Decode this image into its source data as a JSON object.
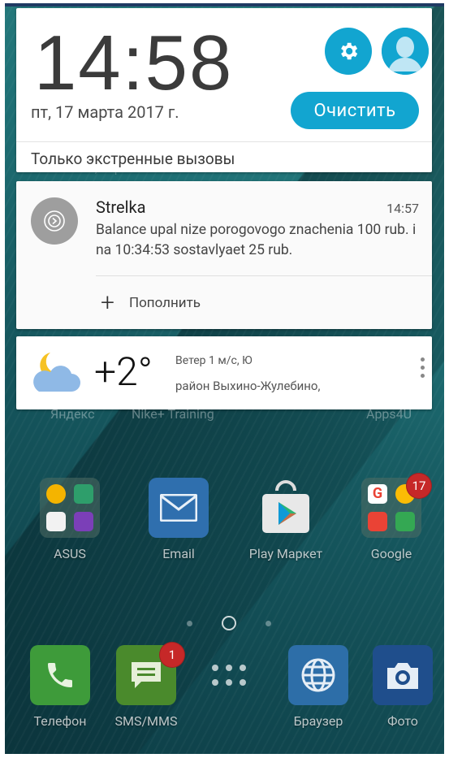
{
  "status_header": {
    "time": "14:58",
    "date": "пт, 17 марта 2017 г.",
    "clear_button": "Очистить",
    "emergency_text": "Только экстренные вызовы",
    "accent_color": "#12a5d0"
  },
  "notification": {
    "app_name": "Strelka",
    "time": "14:57",
    "body": "Balance upal nize porogovogo znachenia 100 rub. i na 10:34:53 sostavlyaet 25 rub.",
    "action_label": "Пополнить"
  },
  "weather": {
    "temperature": "+2°",
    "wind": "Ветер 1 м/с, Ю",
    "location": "район Выхино-Жулебино,"
  },
  "home": {
    "ghost_row": [
      "Яндекс",
      "Nike+ Training",
      "Apps4U"
    ],
    "apps_row": [
      {
        "label": "ASUS"
      },
      {
        "label": "Email"
      },
      {
        "label": "Play Маркет"
      },
      {
        "label": "Google",
        "badge": "17"
      }
    ],
    "dock": [
      {
        "label": "Телефон"
      },
      {
        "label": "SMS/MMS",
        "badge": "1"
      },
      {
        "label": ""
      },
      {
        "label": "Браузер"
      },
      {
        "label": "Фото"
      }
    ]
  }
}
